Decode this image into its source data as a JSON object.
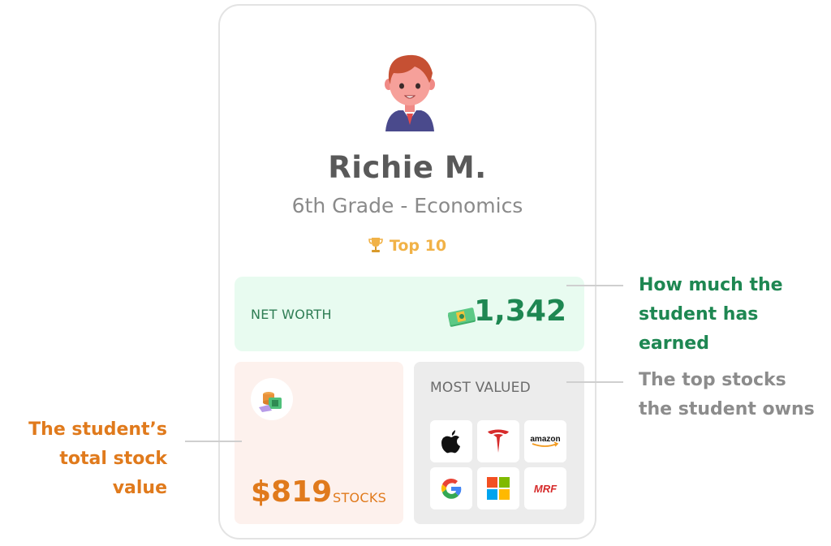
{
  "profile": {
    "name": "Richie M.",
    "grade": "6th Grade - Economics",
    "rank": "Top 10"
  },
  "net_worth": {
    "label": "NET WORTH",
    "value": "1,342",
    "icon": "cash-stack-icon"
  },
  "stocks": {
    "value": "$819",
    "label": "STOCKS",
    "icon": "coins-and-cash-icon"
  },
  "most_valued": {
    "label": "MOST VALUED",
    "logos": [
      {
        "name": "apple-logo-icon"
      },
      {
        "name": "tesla-logo-icon"
      },
      {
        "name": "amazon-logo",
        "text": "amazon"
      },
      {
        "name": "google-logo-icon"
      },
      {
        "name": "microsoft-logo-icon"
      },
      {
        "name": "mrf-logo",
        "text": "MRF"
      }
    ]
  },
  "annotations": {
    "earned_line1": "How much the",
    "earned_line2": "student has earned",
    "top_line1": "The top stocks",
    "top_line2": "the student owns",
    "stock_line1": "The student’s",
    "stock_line2": "total stock value"
  },
  "colors": {
    "green": "#1e8752",
    "orange": "#e07a1c",
    "gold": "#f1b247",
    "gray_annotation": "#8c8c8c"
  }
}
